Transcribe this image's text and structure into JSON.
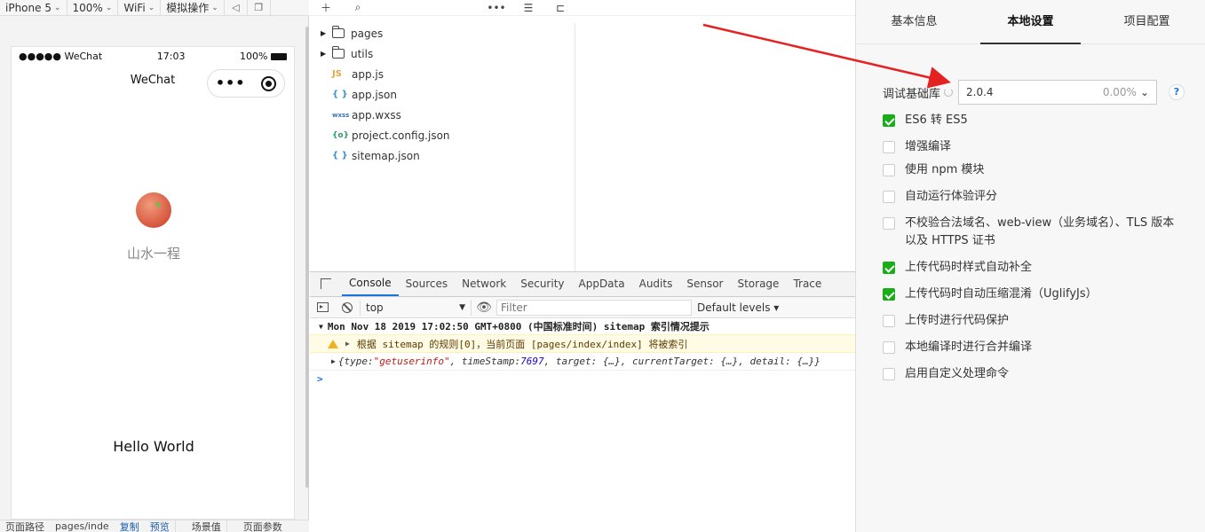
{
  "toolbar": {
    "device": "iPhone 5",
    "zoom": "100%",
    "network": "WiFi",
    "simulate": "模拟操作"
  },
  "phone": {
    "carrier": "●●●●● WeChat",
    "time": "17:03",
    "battery": "100%",
    "nav_title": "WeChat",
    "capsule_dots": "•••",
    "nickname": "山水一程",
    "hello": "Hello World"
  },
  "sim_bottom": {
    "path_label": "页面路径",
    "path_value": "pages/inde",
    "copy": "复制",
    "preview": "预览",
    "scene": "场景值",
    "params": "页面参数"
  },
  "files": [
    {
      "name": "pages",
      "type": "folder"
    },
    {
      "name": "utils",
      "type": "folder"
    },
    {
      "name": "app.js",
      "type": "js",
      "icon": "JS"
    },
    {
      "name": "app.json",
      "type": "json",
      "icon": "{ }"
    },
    {
      "name": "app.wxss",
      "type": "wxss",
      "icon": "wxss"
    },
    {
      "name": "project.config.json",
      "type": "cfg",
      "icon": "{o}"
    },
    {
      "name": "sitemap.json",
      "type": "json",
      "icon": "{ }"
    }
  ],
  "devtools": {
    "tabs": [
      "Console",
      "Sources",
      "Network",
      "Security",
      "AppData",
      "Audits",
      "Sensor",
      "Storage",
      "Trace"
    ],
    "active_tab": "Console",
    "context": "top",
    "filter_placeholder": "Filter",
    "levels": "Default levels",
    "group_header": "Mon Nov 18 2019 17:02:50 GMT+0800 (中国标准时间) sitemap 索引情况提示",
    "warning": "根据 sitemap 的规则[0]，当前页面 [pages/index/index] 将被索引",
    "obj_prefix": "{type: ",
    "obj_type": "\"getuserinfo\"",
    "obj_mid": ", timeStamp: ",
    "obj_ts": "7697",
    "obj_rest": ", target: {…}, currentTarget: {…}, detail: {…}}",
    "prompt": ">"
  },
  "settings": {
    "tabs": [
      "基本信息",
      "本地设置",
      "项目配置"
    ],
    "active_tab": "本地设置",
    "lib_label": "调试基础库",
    "lib_version": "2.0.4",
    "lib_percent": "0.00%",
    "help": "?",
    "options": [
      {
        "label": "ES6 转 ES5",
        "checked": true
      },
      {
        "label": "增强编译",
        "checked": false
      },
      {
        "label": "使用 npm 模块",
        "checked": false
      },
      {
        "label": "自动运行体验评分",
        "checked": false
      },
      {
        "label": "不校验合法域名、web-view（业务域名）、TLS 版本以及 HTTPS 证书",
        "checked": false
      },
      {
        "label": "上传代码时样式自动补全",
        "checked": true
      },
      {
        "label": "上传代码时自动压缩混淆（UglifyJs）",
        "checked": true
      },
      {
        "label": "上传时进行代码保护",
        "checked": false
      },
      {
        "label": "本地编译时进行合并编译",
        "checked": false
      },
      {
        "label": "启用自定义处理命令",
        "checked": false
      }
    ]
  },
  "colors": {
    "accent_green": "#1aad19",
    "annotation_red": "#e52222",
    "devtools_blue": "#1a73e8"
  }
}
